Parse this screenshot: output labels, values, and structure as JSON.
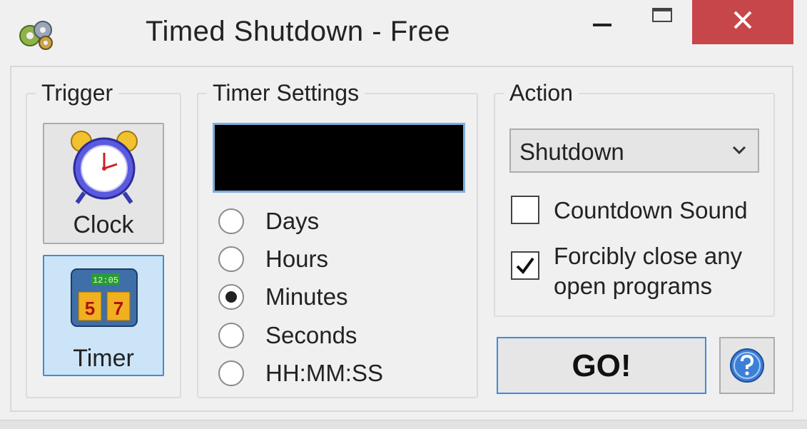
{
  "window": {
    "title": "Timed Shutdown - Free",
    "close_color": "#c7464a"
  },
  "trigger": {
    "legend": "Trigger",
    "clock_label": "Clock",
    "timer_label": "Timer",
    "selected": "Timer",
    "calendar_time": "12:05",
    "calendar_numbers": [
      "5",
      "7"
    ]
  },
  "timer_settings": {
    "legend": "Timer Settings",
    "display_value": "",
    "units": [
      {
        "label": "Days",
        "checked": false
      },
      {
        "label": "Hours",
        "checked": false
      },
      {
        "label": "Minutes",
        "checked": true
      },
      {
        "label": "Seconds",
        "checked": false
      },
      {
        "label": "HH:MM:SS",
        "checked": false
      }
    ]
  },
  "action": {
    "legend": "Action",
    "selected_action": "Shutdown",
    "countdown_sound_label": "Countdown Sound",
    "countdown_sound_checked": false,
    "force_close_label_line1": "Forcibly close any",
    "force_close_label_line2": "open programs",
    "force_close_checked": true
  },
  "buttons": {
    "go_label": "GO!",
    "help_icon": "question-circle-icon"
  }
}
